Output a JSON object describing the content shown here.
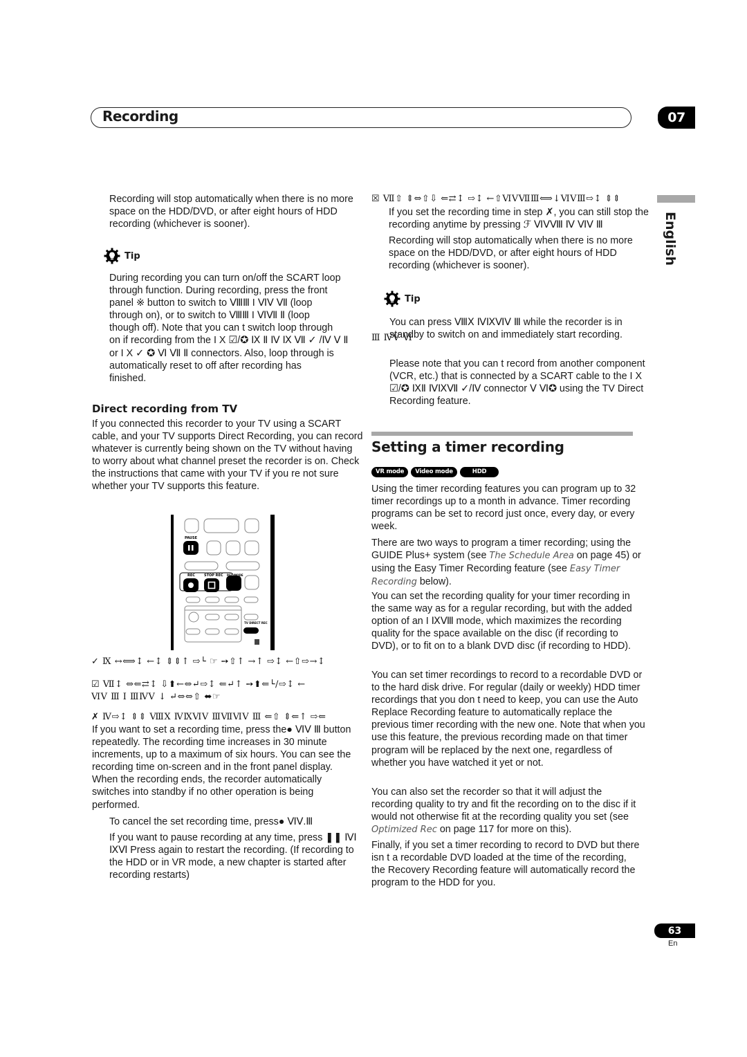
{
  "header": {
    "title": "Recording",
    "chapter": "07"
  },
  "side_tab": {
    "language": "English"
  },
  "left_column": {
    "note_stop": "Recording will stop automatically when there is no more space on the HDD/DVD, or after eight hours of HDD recording (whichever is sooner).",
    "tip1": {
      "label": "Tip",
      "lines": [
        "During recording you can turn on/off the SCART loop",
        "through function. During recording, press the front",
        "panel ※ button to switch to ⅧⅢ I ⅥⅤ Ⅶ (loop",
        "through on), or   to switch to ⅧⅢ I ⅥⅦ Ⅱ (loop",
        "though off). Note that you can t switch loop through",
        "on if recording from the I X ☑/✪ Ⅸ Ⅱ Ⅳ Ⅸ Ⅶ ✓ /Ⅳ Ⅴ Ⅱ",
        "or I X ✓ ✪ Ⅵ Ⅶ Ⅱ connectors. Also, loop through is",
        "automatically reset to off after recording has",
        "finished."
      ]
    },
    "direct_recording": {
      "heading": "Direct recording from TV",
      "body": "If you connected this recorder to your TV using a SCART cable, and your TV supports Direct Recording, you can record whatever is currently being shown on the TV without having to worry about what channel preset the recorder is on. Check the instructions that came with your TV if you re not sure whether your TV supports this feature."
    },
    "remote": {
      "pause_label": "PAUSE",
      "rec_label": "REC",
      "stop_rec_label": "STOP REC",
      "rec_mode_label": "REC MODE",
      "tv_direct_rec_label": "TV DIRECT REC"
    },
    "step1_garbled": "✓  Ⅸ ↔⟺↕ ←↕ ⇕⇕↑ ⇨└ ☞ ➙⇧↑ →↑  ⇨↕ ←⇧⇨→↕",
    "step2_garbled_a": "☑  Ⅶ↕ ⇔⇐⇄↕  ⇩⬆←⇔↵⇨↕  ⇐↵↑ ➙⬆⇐└/⇨↕ ←",
    "step2_garbled_b": "ⅥⅤ Ⅲ I ⅢⅣⅤ  ↓ ↵⇔⇔⇧ ⬌☞",
    "step3_garbled": "✗  Ⅳ⇨↕ ⇕⇕ ⅧⅩ  ⅣⅨⅥⅤ ⅢⅦⅥⅤ Ⅲ  ⇐⇧ ⇕⇐↑  ⇨⇐",
    "step3_body": "If you want to set a recording time, press the● ⅥⅤ Ⅲ button repeatedly. The recording time increases in 30 minute increments, up to a maximum of six hours. You can see the recording time on-screen and in the front panel display. When the recording ends, the recorder automatically switches into standby if no other operation is being performed.",
    "cancel_note": "To cancel the set recording time, press● ⅥⅤ.Ⅲ",
    "pause_note": "If you want to pause recording at any time, press ❚❚ ⅣⅠ ⅨⅥ Press again to restart the recording. (If recording to the HDD or in VR mode, a new chapter is started after recording restarts)"
  },
  "right_column": {
    "step4_garbled": "☒  Ⅶ⇧  ⇕⇔⇧⇩  ⇐⇄↕  ⇨↕ ←⇧ⅥⅤⅦⅢ⟺↓ⅥⅤⅢ⇨↕ ⇕⇕",
    "step4_body": "If you set the recording time in step ✗, you can still stop the recording anytime by pressing ℱ ⅥⅤⅧ Ⅳ  ⅥⅤ Ⅲ",
    "note_stop": "Recording will stop automatically when there is no more space on the HDD/DVD, or after eight hours of HDD recording (whichever is sooner).",
    "tip2": {
      "label": "Tip",
      "para1": "You can press ⅧⅩ  ⅣⅨⅥⅤ Ⅲ while the recorder is in standby to switch on and immediately start recording.",
      "overlap_garble": "Ⅲ ⅣⅤ Ⅵ✪",
      "para2": "Please note that you can t record from another component (VCR, etc.) that is connected by a SCART cable to the I X ☑/✪ ⅨⅡ ⅣⅨⅦ ✓/Ⅳ connector Ⅴ Ⅵ✪ using the TV Direct Recording feature."
    },
    "timer_section": {
      "heading": "Setting a timer recording",
      "modes": [
        "VR mode",
        "Video mode",
        "HDD"
      ],
      "para1": "Using the timer recording features you can program up to 32 timer recordings up to a month in advance. Timer recording programs can be set to record just once, every day, or every week.",
      "para2_a": "There are two ways to program a timer recording; using the GUIDE Plus+ system (see ",
      "para2_link1": "The Schedule Area",
      "para2_b": " on page 45) or using the Easy Timer Recording feature (see ",
      "para2_link2": "Easy Timer Recording",
      "para2_c": " below).",
      "para3": "You can set the recording quality for your timer recording in the same way as for a regular recording, but with the added option of an I ⅨⅧ mode, which maximizes the recording quality for the space available on the disc (if recording to DVD), or to fit on to a blank DVD disc (if recording to HDD).",
      "para4": "You can set timer recordings to record to a recordable DVD or to the hard disk drive. For regular (daily or weekly) HDD timer recordings that you don t need to keep, you can use the Auto Replace Recording feature to automatically replace the previous timer recording with the new one. Note that when you use this feature, the previous recording made on that timer program will be replaced by the next one, regardless of whether you have watched it yet or not.",
      "para5_a": "You can also set the recorder so that it will adjust the recording quality to try and fit the recording on to the disc if it would not otherwise fit at the recording quality you set (see ",
      "para5_link": "Optimized Rec",
      "para5_b": " on page 117 for more on this).",
      "para6": "Finally, if you set a timer recording to record to DVD but there isn t a recordable DVD loaded at the time of the recording, the Recovery Recording feature will automatically record the program to the HDD for you."
    }
  },
  "footer": {
    "page_number": "63",
    "language_code": "En"
  }
}
